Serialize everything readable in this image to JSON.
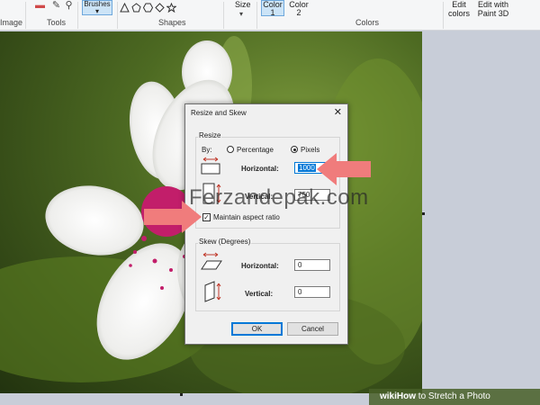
{
  "ribbon": {
    "image_label": "Image",
    "tools_label": "Tools",
    "brushes_label": "Brushes",
    "shapes_label": "Shapes",
    "size_label": "Size",
    "color1_label": "Color\n1",
    "color2_label": "Color\n2",
    "colors_label": "Colors",
    "edit_colors_label": "Edit\ncolors",
    "edit_paint3d_label": "Edit with\nPaint 3D"
  },
  "dialog": {
    "title": "Resize and Skew",
    "close": "✕",
    "resize": {
      "group_title": "Resize",
      "by_label": "By:",
      "percentage_label": "Percentage",
      "pixels_label": "Pixels",
      "selected_mode": "Pixels",
      "horizontal_label": "Horizontal:",
      "horizontal_value": "1000",
      "vertical_label": "Vertical:",
      "vertical_value": "750",
      "maintain_label": "Maintain aspect ratio",
      "maintain_checked": true
    },
    "skew": {
      "group_title": "Skew (Degrees)",
      "horizontal_label": "Horizontal:",
      "horizontal_value": "0",
      "vertical_label": "Vertical:",
      "vertical_value": "0"
    },
    "ok_label": "OK",
    "cancel_label": "Cancel"
  },
  "watermark": "Ferzandepak.com",
  "caption": {
    "wiki": "wiki",
    "how": "How",
    "rest": " to Stretch a Photo"
  },
  "colors": {
    "arrow": "#f07c7c",
    "accent": "#0078d7"
  }
}
